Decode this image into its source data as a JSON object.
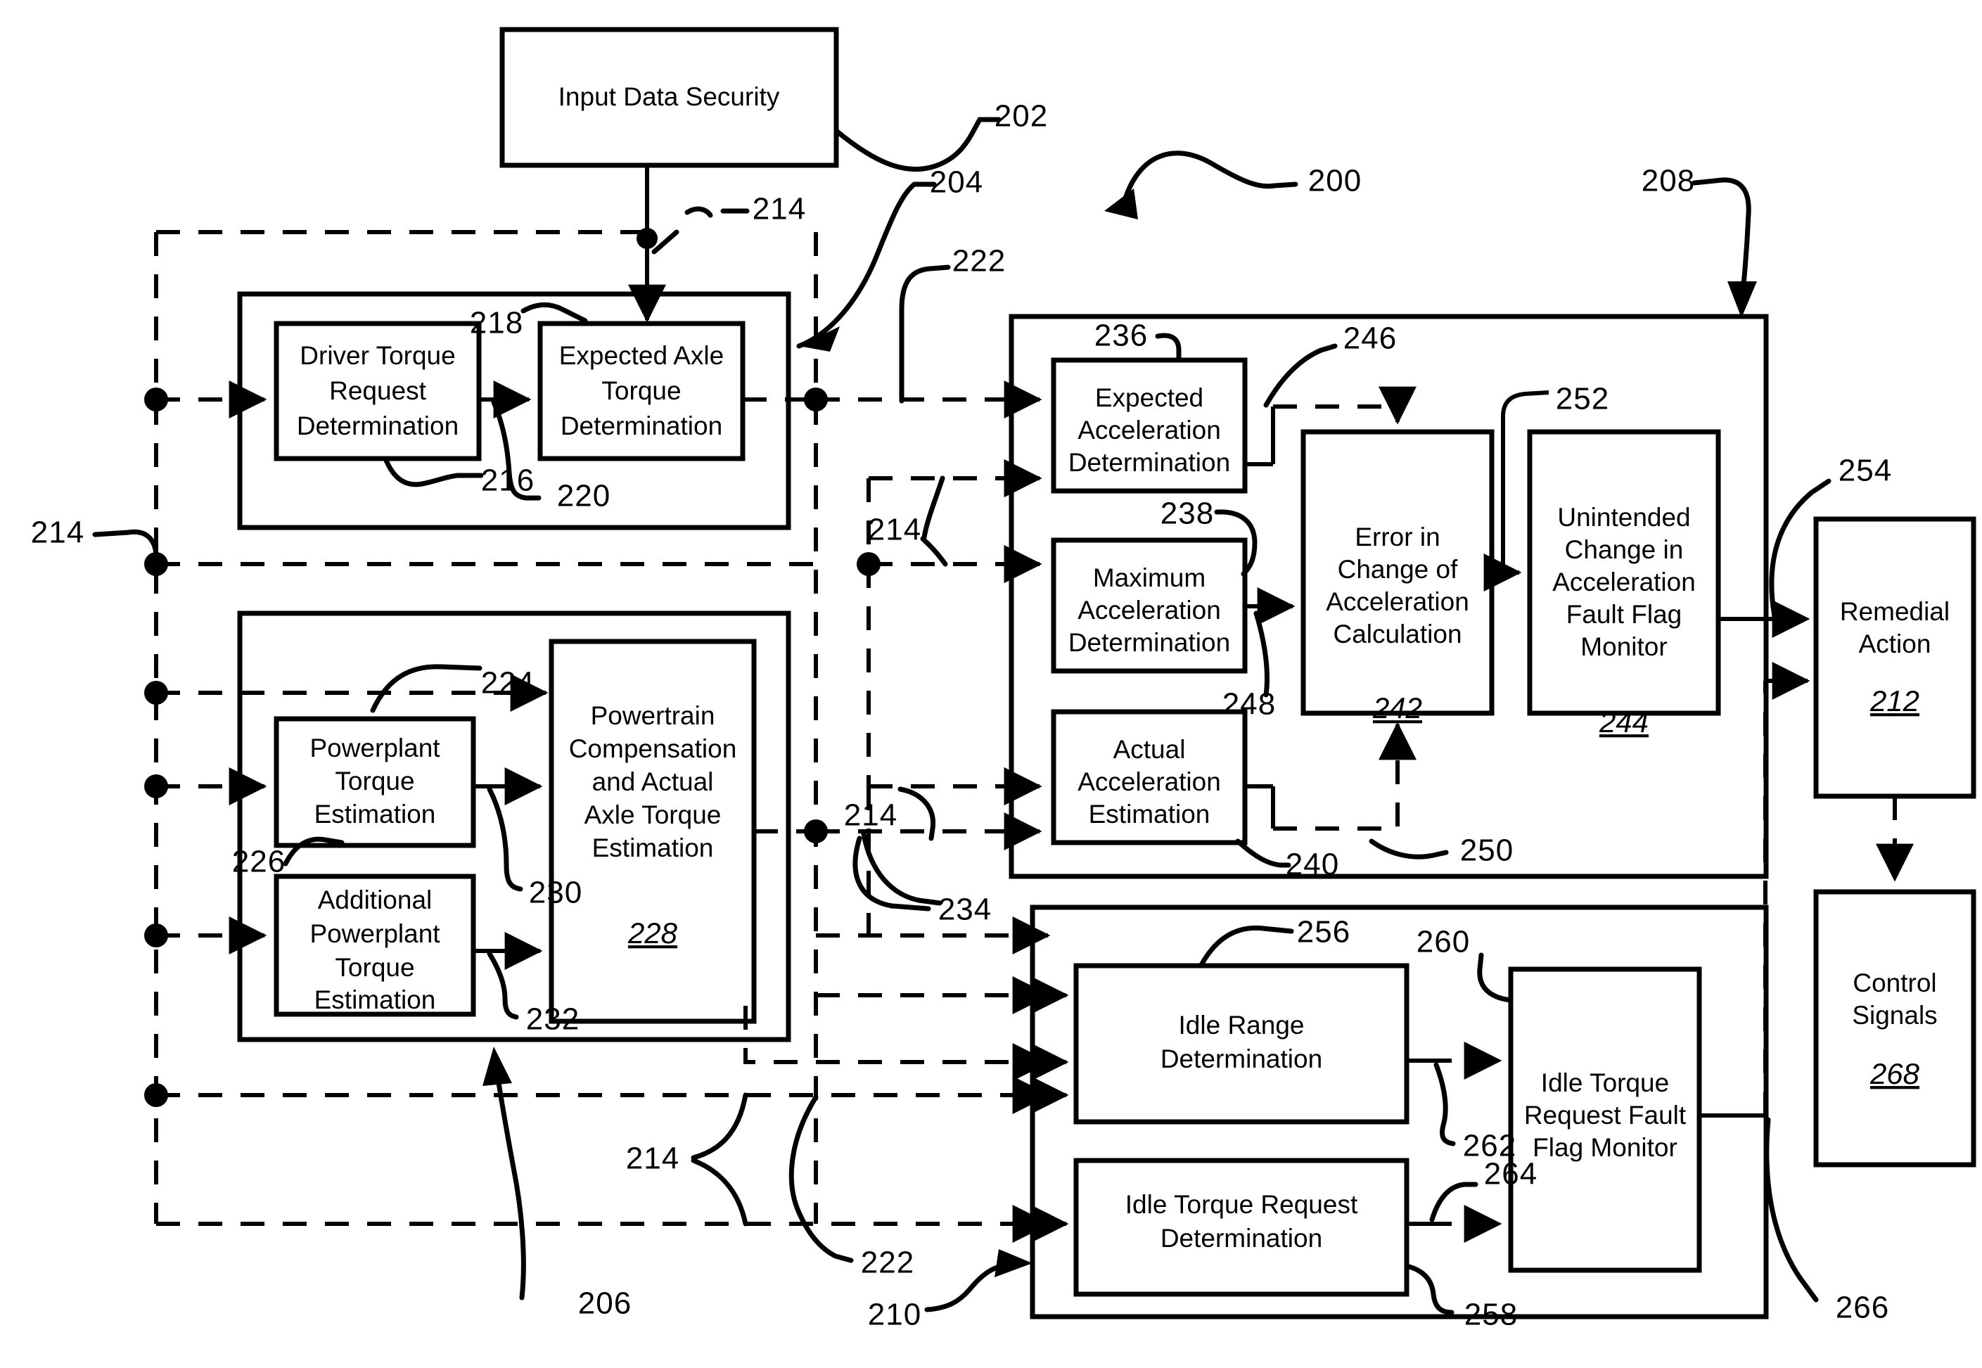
{
  "figure": {
    "type": "patent-block-diagram",
    "overall_ref": "200",
    "blocks": {
      "input_data_security": {
        "label": "Input Data Security",
        "ref": "202"
      },
      "driver_torque_request": {
        "label_l1": "Driver Torque",
        "label_l2": "Request",
        "label_l3": "Determination",
        "ref": "216"
      },
      "expected_axle_torque": {
        "label_l1": "Expected Axle",
        "label_l2": "Torque",
        "label_l3": "Determination",
        "ref": "218"
      },
      "powerplant_torque_estimation": {
        "label_l1": "Powerplant",
        "label_l2": "Torque",
        "label_l3": "Estimation",
        "ref": "226"
      },
      "additional_powerplant_torque_estimation": {
        "label_l1": "Additional",
        "label_l2": "Powerplant",
        "label_l3": "Torque",
        "label_l4": "Estimation",
        "ref": "226"
      },
      "powertrain_compensation": {
        "label_l1": "Powertrain",
        "label_l2": "Compensation",
        "label_l3": "and Actual",
        "label_l4": "Axle Torque",
        "label_l5": "Estimation",
        "ref": "228"
      },
      "expected_acceleration": {
        "label_l1": "Expected",
        "label_l2": "Acceleration",
        "label_l3": "Determination",
        "ref": "236"
      },
      "maximum_acceleration": {
        "label_l1": "Maximum",
        "label_l2": "Acceleration",
        "label_l3": "Determination",
        "ref": "238"
      },
      "actual_acceleration": {
        "label_l1": "Actual",
        "label_l2": "Acceleration",
        "label_l3": "Estimation",
        "ref": "240"
      },
      "error_change_acceleration": {
        "label_l1": "Error in",
        "label_l2": "Change of",
        "label_l3": "Acceleration",
        "label_l4": "Calculation",
        "ref": "242"
      },
      "unintended_change": {
        "label_l1": "Unintended",
        "label_l2": "Change in",
        "label_l3": "Acceleration",
        "label_l4": "Fault Flag",
        "label_l5": "Monitor",
        "ref": "244"
      },
      "remedial_action": {
        "label_l1": "Remedial",
        "label_l2": "Action",
        "ref": "212"
      },
      "control_signals": {
        "label_l1": "Control",
        "label_l2": "Signals",
        "ref": "268"
      },
      "idle_range": {
        "label_l1": "Idle Range",
        "label_l2": "Determination",
        "ref": "256"
      },
      "idle_torque_request": {
        "label_l1": "Idle Torque Request",
        "label_l2": "Determination",
        "ref": "258"
      },
      "idle_torque_fault_flag": {
        "label_l1": "Idle Torque",
        "label_l2": "Request Fault",
        "label_l3": "Flag Monitor",
        "ref": "260"
      }
    },
    "reference_numerals": {
      "r200": "200",
      "r202": "202",
      "r204": "204",
      "r206": "206",
      "r208": "208",
      "r210": "210",
      "r212": "212",
      "r214a": "214",
      "r214b": "214",
      "r214c": "214",
      "r214d": "214",
      "r214e": "214",
      "r214f": "214",
      "r216": "216",
      "r218": "218",
      "r220": "220",
      "r222a": "222",
      "r222b": "222",
      "r224": "224",
      "r226": "226",
      "r228": "228",
      "r230": "230",
      "r232": "232",
      "r234": "234",
      "r236": "236",
      "r238": "238",
      "r240": "240",
      "r242": "242",
      "r244": "244",
      "r246": "246",
      "r248": "248",
      "r250": "250",
      "r252": "252",
      "r254": "254",
      "r256": "256",
      "r258": "258",
      "r260": "260",
      "r262": "262",
      "r264": "264",
      "r266": "266",
      "r268": "268"
    },
    "colors": {
      "ink": "#000000",
      "paper": "#ffffff"
    }
  }
}
